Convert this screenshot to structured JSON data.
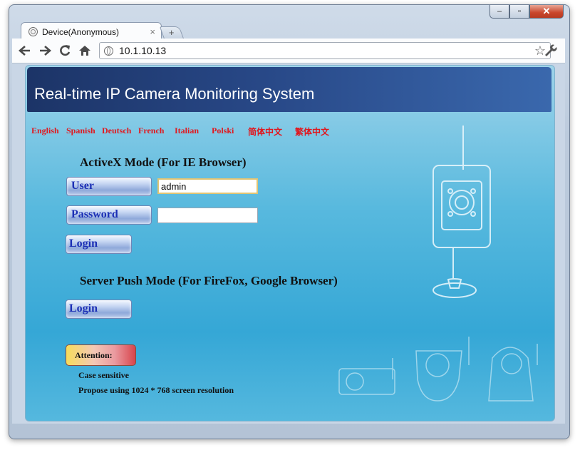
{
  "browser": {
    "tab_title": "Device(Anonymous)",
    "tab_close": "×",
    "new_tab": "+",
    "url": "10.1.10.13",
    "caption": {
      "minimize": "–",
      "maximize": "▫",
      "close": "✕"
    },
    "icons": {
      "back": "back-arrow-icon",
      "forward": "forward-arrow-icon",
      "reload": "reload-icon",
      "home": "home-icon",
      "star": "star-icon",
      "wrench": "wrench-icon"
    }
  },
  "page": {
    "banner_title": "Real-time IP Camera Monitoring System",
    "languages": [
      "English",
      "Spanish",
      "Deutsch",
      "French",
      "Italian",
      "Polski",
      "简体中文",
      "繁体中文"
    ],
    "activex": {
      "title": "ActiveX Mode (For IE Browser)",
      "user_label": "User",
      "user_value": "admin",
      "password_label": "Password",
      "password_value": "",
      "login_label": "Login"
    },
    "server_push": {
      "title": "Server Push Mode (For FireFox, Google Browser)",
      "login_label": "Login"
    },
    "attention": {
      "label": "Attention:",
      "notes": [
        "Case sensitive",
        "Propose using 1024 * 768 screen resolution"
      ]
    },
    "colors": {
      "language_link": "#e0181f",
      "button_text": "#1b2fb5",
      "banner": "#284887"
    }
  }
}
